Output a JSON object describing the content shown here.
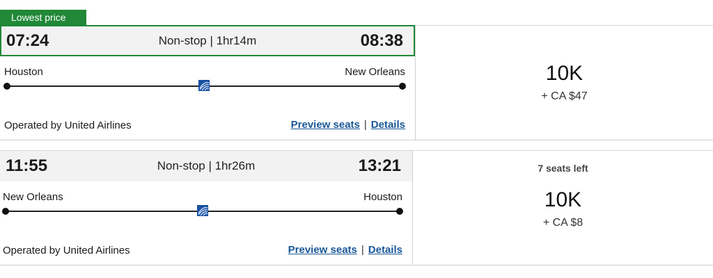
{
  "badge": {
    "label": "Lowest price",
    "color": "#208837"
  },
  "flights": [
    {
      "departure_time": "07:24",
      "duration": "Non-stop | 1hr14m",
      "arrival_time": "08:38",
      "origin": "Houston",
      "destination": "New Orleans",
      "operated_by": "Operated by United Airlines",
      "preview_seats_label": "Preview seats",
      "separator": "|",
      "details_label": "Details",
      "price_miles": "10K",
      "price_cash": "+ CA $47",
      "seats_left": ""
    },
    {
      "departure_time": "11:55",
      "duration": "Non-stop | 1hr26m",
      "arrival_time": "13:21",
      "origin": "New Orleans",
      "destination": "Houston",
      "operated_by": "Operated by United Airlines",
      "preview_seats_label": "Preview seats",
      "separator": "|",
      "details_label": "Details",
      "price_miles": "10K",
      "price_cash": "+ CA $8",
      "seats_left": "7 seats left"
    }
  ],
  "icons": {
    "airline_logo": "united-globe-icon"
  },
  "colors": {
    "highlight": "#208837",
    "link": "#1a5796"
  }
}
